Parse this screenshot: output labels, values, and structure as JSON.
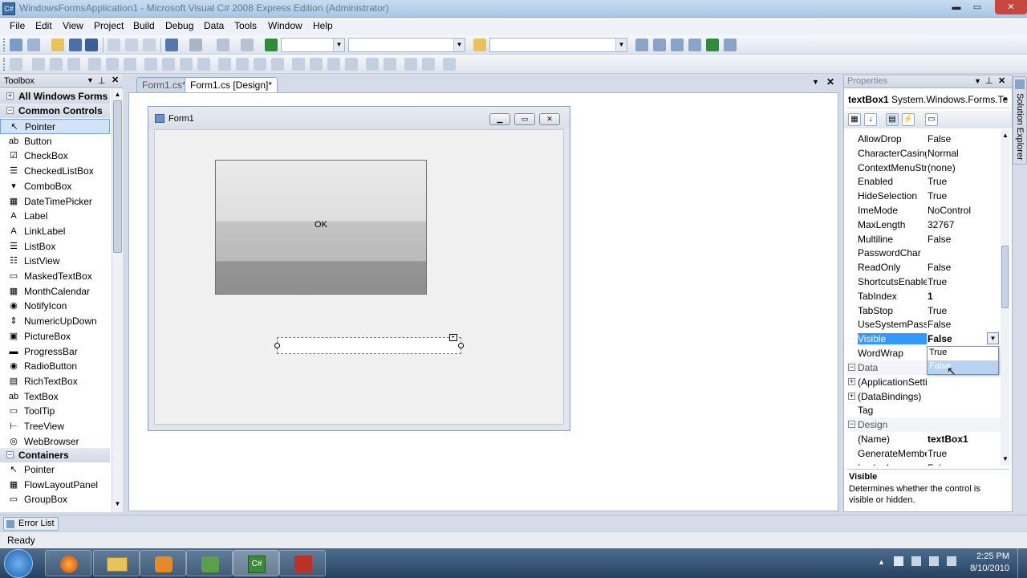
{
  "window": {
    "title": "WindowsFormsApplication1 - Microsoft Visual C# 2008 Express Edition (Administrator)",
    "controls": {
      "minimize": "▬",
      "maximize": "▭",
      "close": "✕"
    }
  },
  "menu": [
    "File",
    "Edit",
    "View",
    "Project",
    "Build",
    "Debug",
    "Data",
    "Tools",
    "Window",
    "Help"
  ],
  "toolbox": {
    "title": "Toolbox",
    "all_forms": "All Windows Forms",
    "common_header": "Common Controls",
    "common_items": [
      "Pointer",
      "Button",
      "CheckBox",
      "CheckedListBox",
      "ComboBox",
      "DateTimePicker",
      "Label",
      "LinkLabel",
      "ListBox",
      "ListView",
      "MaskedTextBox",
      "MonthCalendar",
      "NotifyIcon",
      "NumericUpDown",
      "PictureBox",
      "ProgressBar",
      "RadioButton",
      "RichTextBox",
      "TextBox",
      "ToolTip",
      "TreeView",
      "WebBrowser"
    ],
    "containers_header": "Containers",
    "containers_items": [
      "Pointer",
      "FlowLayoutPanel",
      "GroupBox"
    ]
  },
  "tabs": [
    {
      "label": "Form1.cs*"
    },
    {
      "label": "Form1.cs [Design]*"
    }
  ],
  "designer": {
    "form_title": "Form1",
    "ok_button": "OK"
  },
  "properties": {
    "title": "Properties",
    "object_name": "textBox1",
    "object_type": "System.Windows.Forms.Te",
    "rows": [
      {
        "name": "AllowDrop",
        "value": "False"
      },
      {
        "name": "CharacterCasing",
        "value": "Normal"
      },
      {
        "name": "ContextMenuStrip",
        "value": "(none)"
      },
      {
        "name": "Enabled",
        "value": "True"
      },
      {
        "name": "HideSelection",
        "value": "True"
      },
      {
        "name": "ImeMode",
        "value": "NoControl"
      },
      {
        "name": "MaxLength",
        "value": "32767"
      },
      {
        "name": "Multiline",
        "value": "False"
      },
      {
        "name": "PasswordChar",
        "value": ""
      },
      {
        "name": "ReadOnly",
        "value": "False"
      },
      {
        "name": "ShortcutsEnabled",
        "value": "True"
      },
      {
        "name": "TabIndex",
        "value": "1"
      },
      {
        "name": "TabStop",
        "value": "True"
      },
      {
        "name": "UseSystemPasswordChar",
        "value": "False"
      },
      {
        "name": "Visible",
        "value": "False"
      },
      {
        "name": "WordWrap",
        "value": "True"
      }
    ],
    "cat_rows": [
      {
        "name": "Data",
        "value": ""
      },
      {
        "name": "(ApplicationSettings)",
        "value": ""
      },
      {
        "name": "(DataBindings)",
        "value": ""
      },
      {
        "name": "Tag",
        "value": ""
      },
      {
        "name": "Design",
        "value": ""
      },
      {
        "name": "(Name)",
        "value": "textBox1"
      },
      {
        "name": "GenerateMember",
        "value": "True"
      },
      {
        "name": "Locked",
        "value": "False"
      }
    ],
    "dropdown_options": [
      "True",
      "False"
    ],
    "description_title": "Visible",
    "description_text": "Determines whether the control is visible or hidden."
  },
  "side_tab": "Solution Explorer",
  "error_list": "Error List",
  "status": "Ready",
  "clock": {
    "time": "2:25 PM",
    "date": "8/10/2010"
  },
  "colors": {
    "selection": "#3399ff",
    "accent": "#c7463e"
  }
}
